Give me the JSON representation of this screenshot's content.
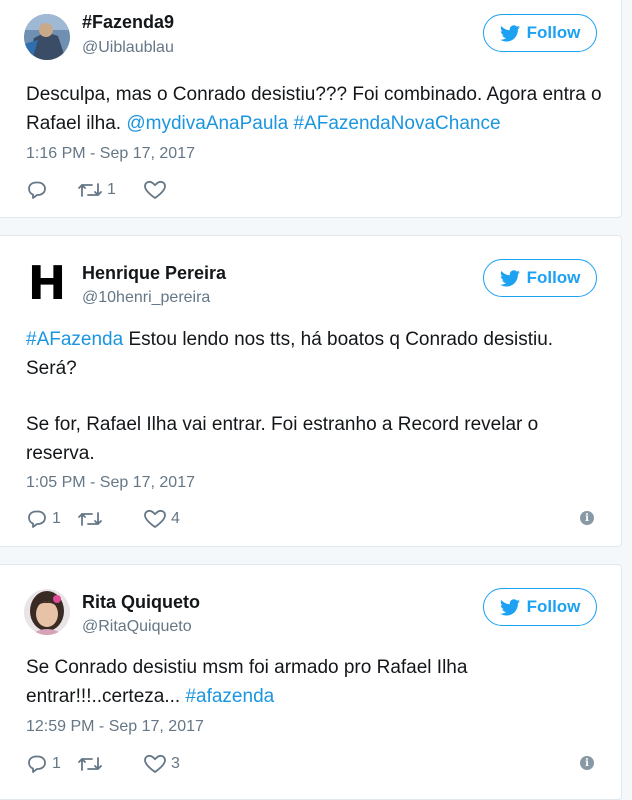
{
  "colors": {
    "link": "#1b95e0",
    "follow": "#1da1f2",
    "muted": "#657786"
  },
  "tweets": [
    {
      "name": "#Fazenda9",
      "handle": "@Uiblaublau",
      "follow_label": "Follow",
      "text_a": "Desculpa, mas o Conrado desistiu??? Foi combinado. Agora entra o Rafael ilha. ",
      "mention": "@mydivaAnaPaula",
      "hashtag": "#AFazendaNovaChance",
      "time": "1:16 PM - Sep 17, 2017",
      "reply_count": "",
      "retweet_count": "1",
      "like_count": ""
    },
    {
      "name": "Henrique Pereira",
      "handle": "@10henri_pereira",
      "avatar_letter": "H",
      "follow_label": "Follow",
      "hashtag": "#AFazenda",
      "text_a": " Estou lendo nos tts, há boatos q Conrado desistiu. Será?",
      "text_b": "Se for, Rafael Ilha vai entrar. Foi estranho a Record revelar o reserva.",
      "time": "1:05 PM - Sep 17, 2017",
      "reply_count": "1",
      "retweet_count": "",
      "like_count": "4",
      "info_label": "i"
    },
    {
      "name": "Rita Quiqueto",
      "handle": "@RitaQuiqueto",
      "follow_label": "Follow",
      "text_a": "Se Conrado desistiu msm foi armado pro Rafael Ilha entrar!!!..certeza... ",
      "hashtag": "#afazenda",
      "time": "12:59 PM - Sep 17, 2017",
      "reply_count": "1",
      "retweet_count": "",
      "like_count": "3",
      "info_label": "i"
    }
  ]
}
